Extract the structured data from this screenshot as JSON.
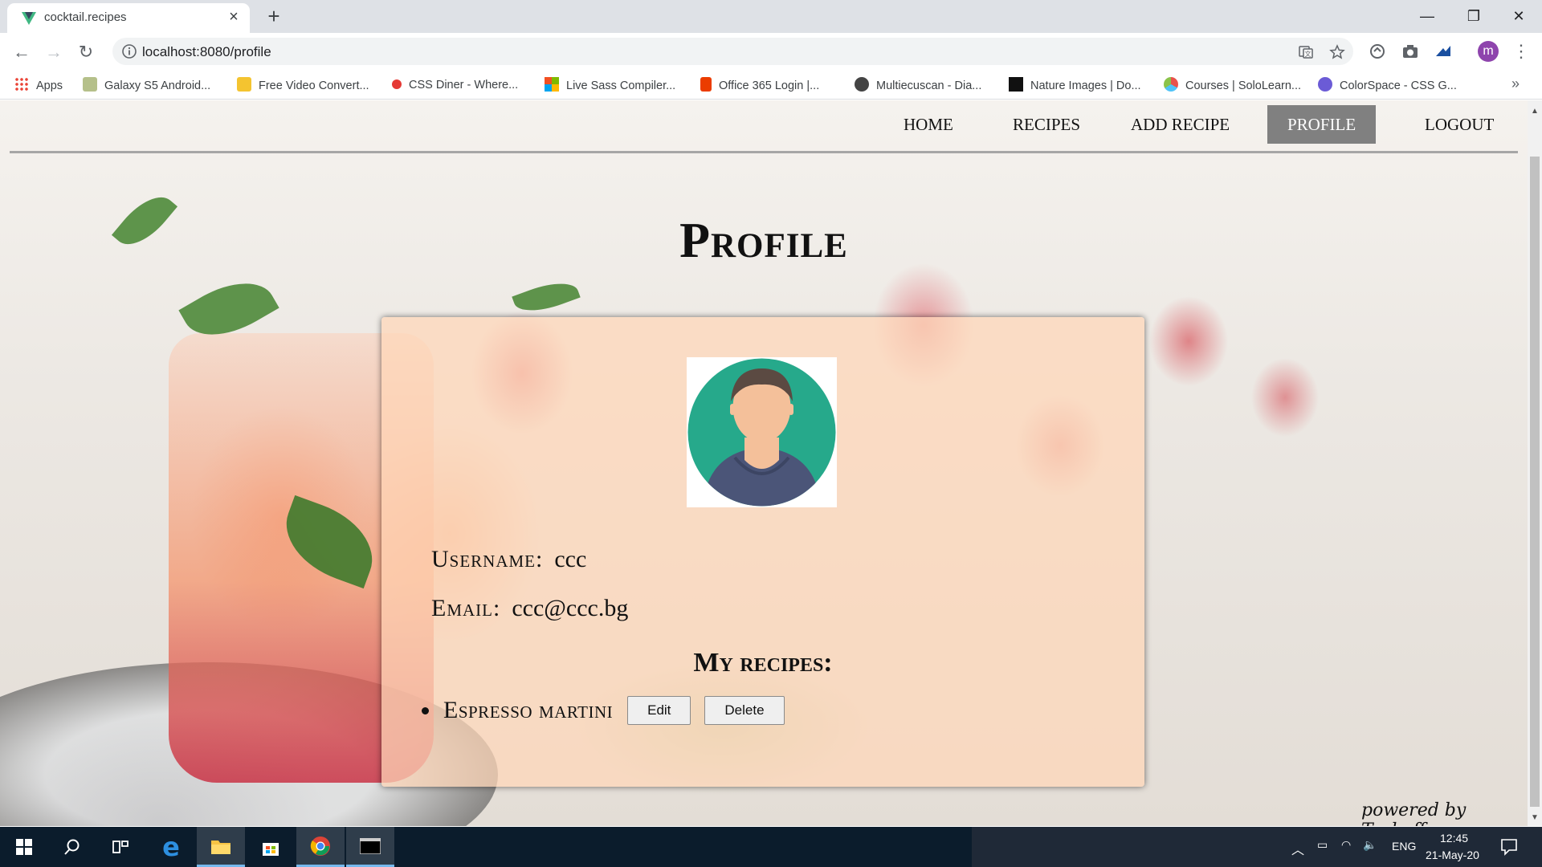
{
  "browser": {
    "tab_title": "cocktail.recipes",
    "url": "localhost:8080/profile",
    "profile_initial": "m",
    "bookmarks": [
      {
        "label": "Apps",
        "icon": "apps-grid-icon",
        "color": "#4285f4"
      },
      {
        "label": "Galaxy S5 Android...",
        "icon": "android-icon",
        "color": "#b5c08a"
      },
      {
        "label": "Free Video Convert...",
        "icon": "video-converter-icon",
        "color": "#f4c430"
      },
      {
        "label": "CSS Diner - Where...",
        "icon": "css-diner-icon",
        "color": "#e53935"
      },
      {
        "label": "Live Sass Compiler...",
        "icon": "microsoft-icon",
        "color": "#f25022"
      },
      {
        "label": "Office 365 Login |...",
        "icon": "office-icon",
        "color": "#eb3c00"
      },
      {
        "label": "Multiecuscan - Dia...",
        "icon": "globe-icon",
        "color": "#444444"
      },
      {
        "label": "Nature Images | Do...",
        "icon": "unsplash-icon",
        "color": "#111111"
      },
      {
        "label": "Courses | SoloLearn...",
        "icon": "sololearn-icon",
        "color": "#e8524b"
      },
      {
        "label": "ColorSpace - CSS G...",
        "icon": "colorspace-icon",
        "color": "#6b5bd6"
      }
    ]
  },
  "nav": {
    "home": "HOME",
    "recipes": "RECIPES",
    "add_recipe": "ADD RECIPE",
    "profile": "PROFILE",
    "logout": "LOGOUT",
    "active": "PROFILE"
  },
  "page": {
    "title": "Profile",
    "username_label": "Username:",
    "username": "ccc",
    "email_label": "Email:",
    "email": "ccc@ccc.bg",
    "recipes_heading": "My recipes:",
    "recipes": [
      {
        "name": "Espresso martini",
        "edit_label": "Edit",
        "delete_label": "Delete"
      }
    ],
    "footer": "powered by Taskoff"
  },
  "taskbar": {
    "language": "ENG",
    "time": "12:45",
    "date": "21-May-20"
  },
  "colors": {
    "nav_active_bg": "#808080",
    "card_bg": "rgba(255,215,185,0.72)",
    "avatar_circle": "#26a98b",
    "avatar_shirt": "#4b5578"
  }
}
